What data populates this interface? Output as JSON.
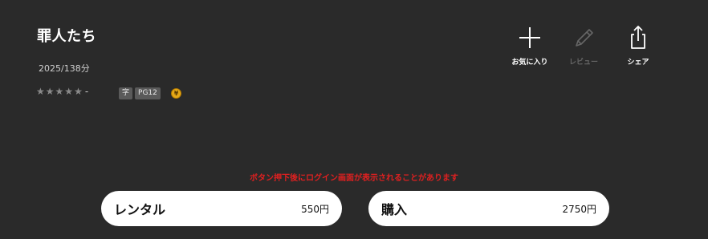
{
  "movie": {
    "title": "罪人たち",
    "meta": "2025/138分",
    "rating_stars": 0,
    "rating_value": "-",
    "tags": [
      "字",
      "PG12"
    ],
    "coin_symbol": "¥"
  },
  "actions": {
    "favorite_label": "お気に入り",
    "review_label": "レビュー",
    "share_label": "シェア"
  },
  "notice": "ボタン押下後にログイン画面が表示されることがあります",
  "purchase": {
    "rental_label": "レンタル",
    "rental_price": "550円",
    "buy_label": "購入",
    "buy_price": "2750円"
  },
  "colors": {
    "background": "#2a2a2a",
    "notice": "#e02020",
    "coin": "#e6a817"
  }
}
